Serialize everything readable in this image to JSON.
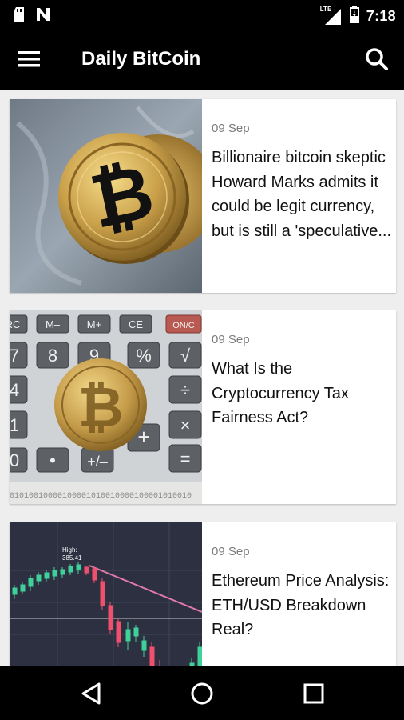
{
  "status_bar": {
    "time": "7:18",
    "network_label": "LTE",
    "icons": [
      "sd-card-icon",
      "n-notification-icon",
      "signal-icon",
      "battery-icon"
    ]
  },
  "app_bar": {
    "title": "Daily BitCoin",
    "menu_icon": "menu-icon",
    "search_icon": "search-icon"
  },
  "articles": [
    {
      "date": "09 Sep",
      "title": "Billionaire bitcoin skeptic Howard Marks admits it could be legit currency, but is still a 'speculative...",
      "image": "gold bitcoin coins on stone surface"
    },
    {
      "date": "09 Sep",
      "title": "What Is the Cryptocurrency Tax Fairness Act?",
      "image": "bitcoin coin on calculator keypad"
    },
    {
      "date": "09 Sep",
      "title": "Ethereum Price Analysis: ETH/USD Breakdown Real?",
      "image": "candlestick price chart",
      "chart_annotation": [
        "High:",
        "385.41"
      ]
    }
  ],
  "nav_bar": {
    "icons": [
      "back-icon",
      "home-icon",
      "recents-icon"
    ]
  },
  "colors": {
    "bars": "#000000",
    "background": "#eeeeee",
    "card": "#ffffff",
    "date_text": "#7a7a7a",
    "title_text": "#111111"
  }
}
